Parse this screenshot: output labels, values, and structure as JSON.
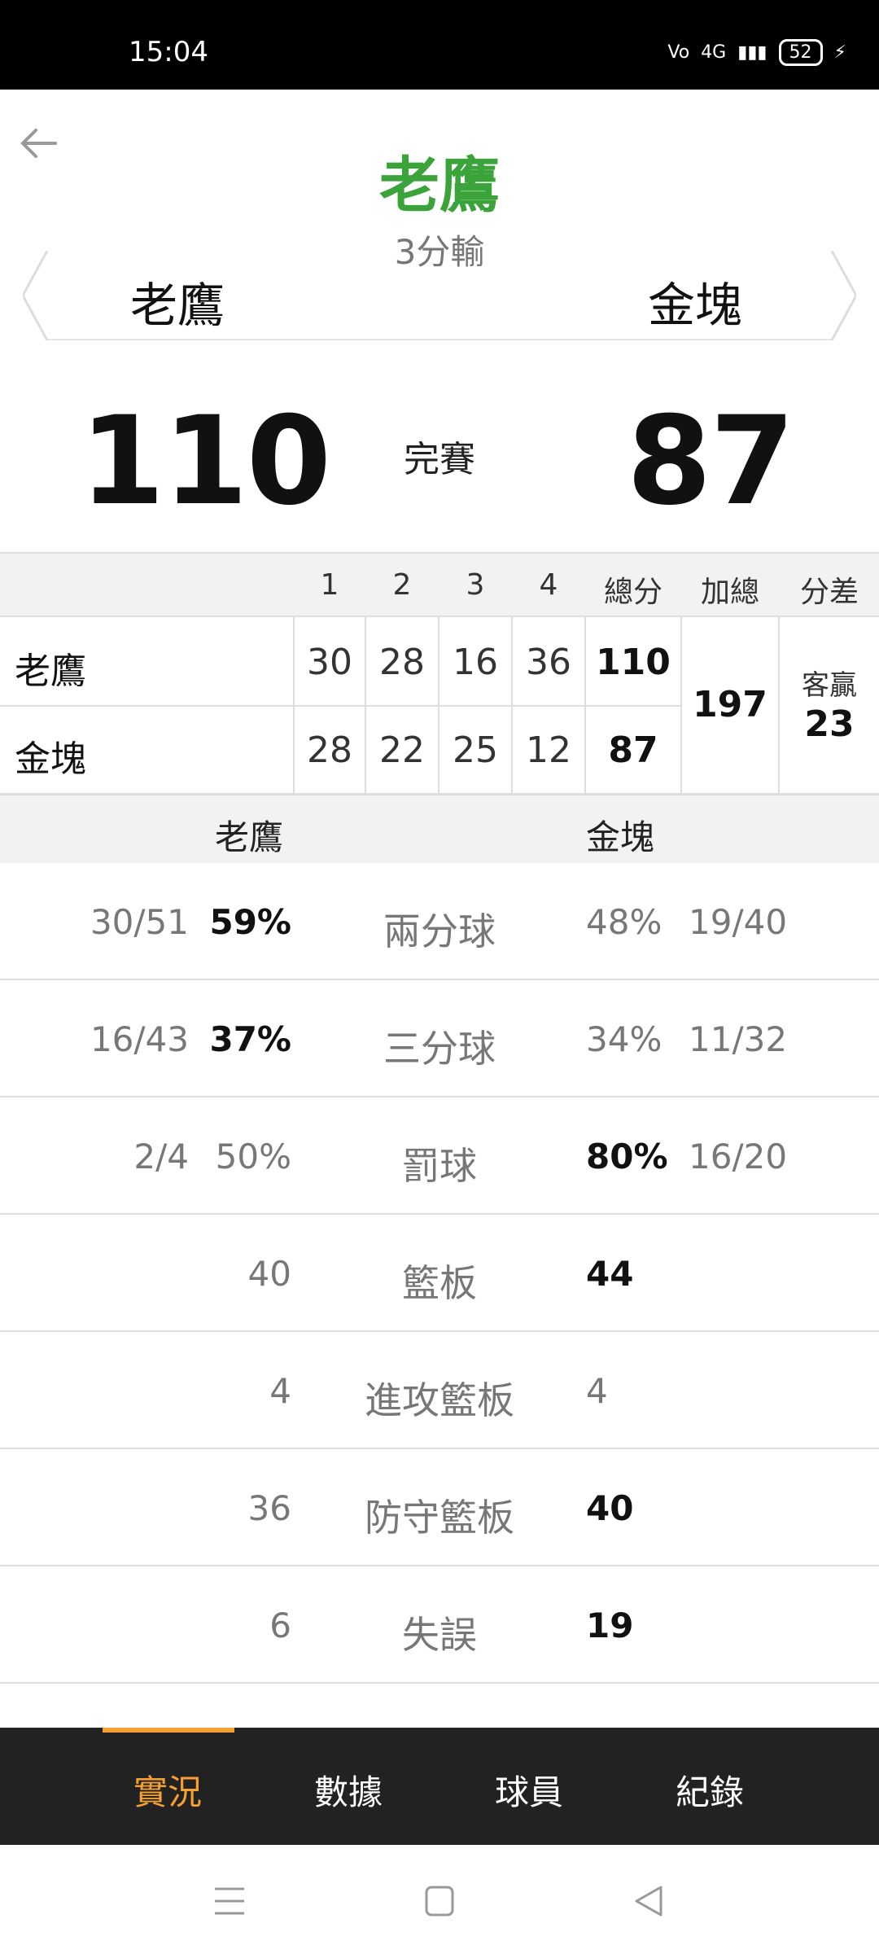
{
  "status_bar": {
    "time": "15:04",
    "network": "4G",
    "battery": "52"
  },
  "header": {
    "winner": "老鷹",
    "result": "3分輸",
    "home_team": "老鷹",
    "away_team": "金塊"
  },
  "score": {
    "home": "110",
    "status": "完賽",
    "away": "87"
  },
  "quarter_table": {
    "headers": [
      "1",
      "2",
      "3",
      "4",
      "總分",
      "加總",
      "分差"
    ],
    "rows": [
      {
        "team": "老鷹",
        "q": [
          "30",
          "28",
          "16",
          "36"
        ],
        "total": "110"
      },
      {
        "team": "金塊",
        "q": [
          "28",
          "22",
          "25",
          "12"
        ],
        "total": "87"
      }
    ],
    "sum": "197",
    "diff_label": "客贏",
    "diff": "23"
  },
  "stats": {
    "home_team": "老鷹",
    "away_team": "金塊",
    "rows": [
      {
        "label": "兩分球",
        "home_frac": "30/51",
        "home_pct": "59%",
        "away_pct": "48%",
        "away_frac": "19/40",
        "better": "home"
      },
      {
        "label": "三分球",
        "home_frac": "16/43",
        "home_pct": "37%",
        "away_pct": "34%",
        "away_frac": "11/32",
        "better": "home"
      },
      {
        "label": "罰球",
        "home_frac": "2/4",
        "home_pct": "50%",
        "away_pct": "80%",
        "away_frac": "16/20",
        "better": "away"
      },
      {
        "label": "籃板",
        "home_frac": "",
        "home_pct": "40",
        "away_pct": "44",
        "away_frac": "",
        "better": "away"
      },
      {
        "label": "進攻籃板",
        "home_frac": "",
        "home_pct": "4",
        "away_pct": "4",
        "away_frac": "",
        "better": "none"
      },
      {
        "label": "防守籃板",
        "home_frac": "",
        "home_pct": "36",
        "away_pct": "40",
        "away_frac": "",
        "better": "away"
      },
      {
        "label": "失誤",
        "home_frac": "",
        "home_pct": "6",
        "away_pct": "19",
        "away_frac": "",
        "better": "away"
      }
    ]
  },
  "tabs": [
    {
      "label": "實況",
      "active": true
    },
    {
      "label": "數據",
      "active": false
    },
    {
      "label": "球員",
      "active": false
    },
    {
      "label": "紀錄",
      "active": false
    }
  ],
  "colors": {
    "winner": "#3aa33a",
    "tab_active": "#f5a032",
    "tabbar_bg": "#222222"
  }
}
